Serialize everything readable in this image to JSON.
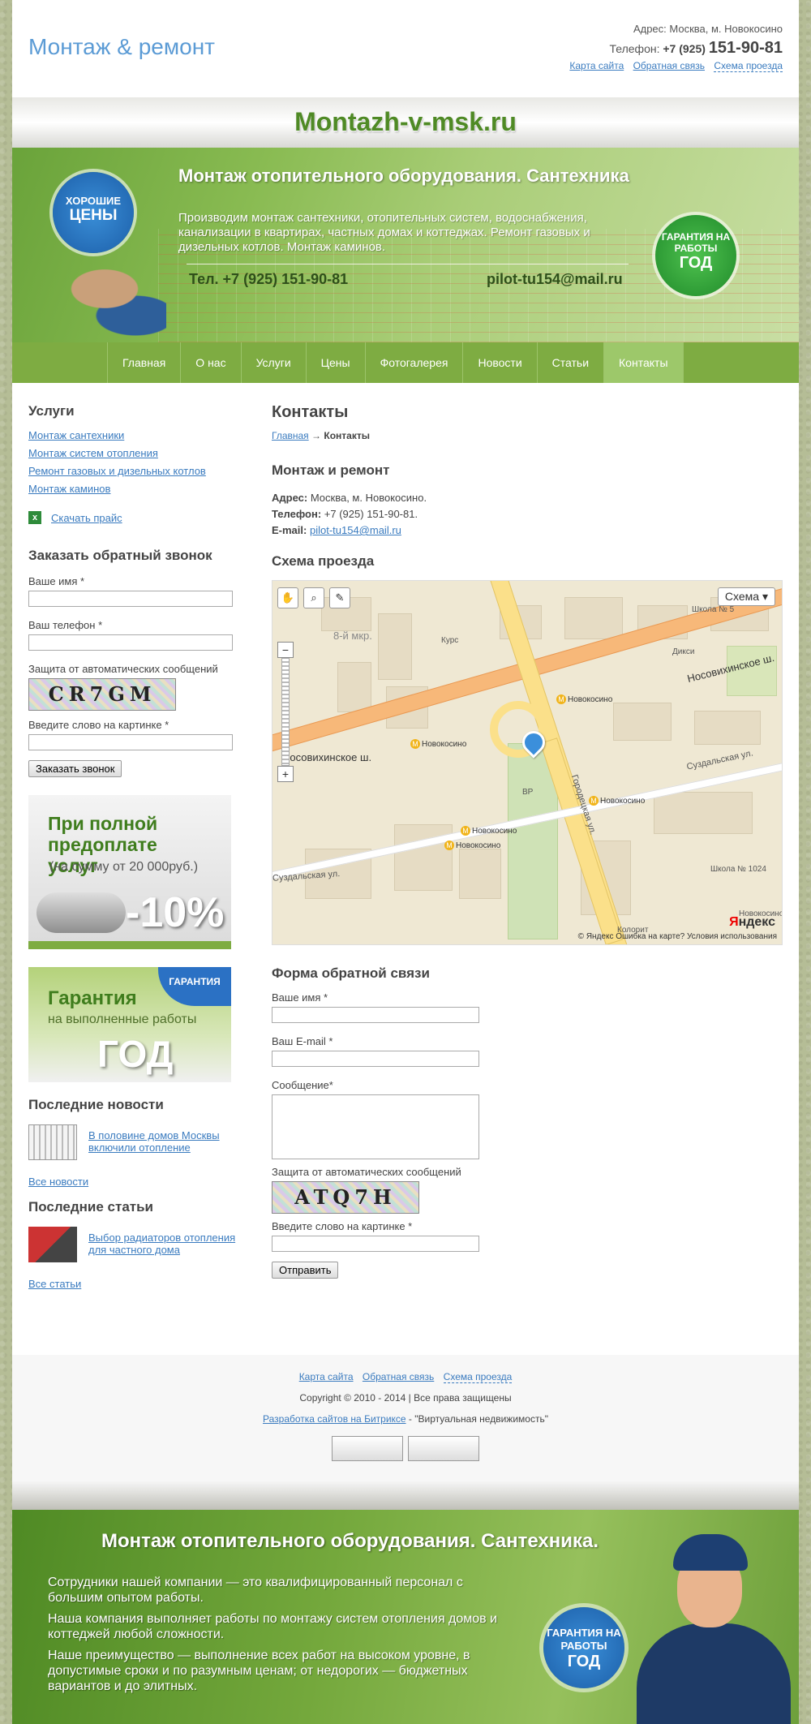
{
  "header": {
    "site_title": "Монтаж & ремонт",
    "address": "Адрес: Москва, м. Новокосино",
    "phone_label": "Телефон:",
    "phone_code": "+7 (925)",
    "phone_number": "151-90-81",
    "links": [
      "Карта сайта",
      "Обратная связь",
      "Схема проезда"
    ]
  },
  "banner": {
    "domain": "Montazh-v-msk.ru",
    "title": "Монтаж отопительного оборудования. Сантехника",
    "text": "Производим монтаж сантехники, отопительных систем, водоснабжения, канализации в квартирах, частных домах и коттеджах. Ремонт газовых и дизельных котлов. Монтаж каминов.",
    "phone": "Тел. +7 (925) 151-90-81",
    "email": "pilot-tu154@mail.ru",
    "badge_prices_small": "ХОРОШИЕ",
    "badge_prices_big": "ЦЕНЫ",
    "badge_guarantee_small": "ГАРАНТИЯ НА РАБОТЫ",
    "badge_guarantee_big": "ГОД"
  },
  "nav": {
    "items": [
      "Главная",
      "О нас",
      "Услуги",
      "Цены",
      "Фотогалерея",
      "Новости",
      "Статьи",
      "Контакты"
    ],
    "active": "Контакты"
  },
  "sidebar": {
    "services_title": "Услуги",
    "services": [
      "Монтаж сантехники",
      "Монтаж систем отопления",
      "Ремонт газовых и дизельных котлов",
      "Монтаж каминов"
    ],
    "price_link": "Скачать прайс",
    "callback": {
      "title": "Заказать обратный звонок",
      "name_label": "Ваше имя *",
      "phone_label": "Ваш телефон *",
      "captcha_label": "Защита от автоматических сообщений",
      "captcha_text": "CR7GM",
      "word_label": "Введите слово на картинке *",
      "button": "Заказать звонок"
    },
    "promo_discount": {
      "line1": "При полной предоплате услуг",
      "line2": "(на сумму от 20 000руб.)",
      "line3": "-10%"
    },
    "promo_guarantee": {
      "tag": "ГАРАНТИЯ",
      "line1": "Гарантия",
      "line2": "на выполненные работы",
      "line3": "ГОД"
    },
    "news_title": "Последние новости",
    "news_item": "В половине домов Москвы включили отопление",
    "news_all": "Все новости",
    "articles_title": "Последние статьи",
    "article_item": "Выбор радиаторов отопления для частного дома",
    "articles_all": "Все статьи"
  },
  "main": {
    "title": "Контакты",
    "breadcrumb_home": "Главная",
    "breadcrumb_sep": "→",
    "breadcrumb_current": "Контакты",
    "company": "Монтаж и ремонт",
    "address_label": "Адрес:",
    "address_value": "Москва, м. Новокосино.",
    "phone_label": "Телефон:",
    "phone_value": "+7 (925) 151-90-81.",
    "email_label": "E-mail:",
    "email_value": "pilot-tu154@mail.ru",
    "map_title": "Схема проезда",
    "map": {
      "type_label": "Схема ▾",
      "district": "8-й мкр.",
      "streets": [
        "Носовихинское ш.",
        "Носовихинское ш.",
        "Суздальская ул.",
        "Городецкая ул.",
        "Суздальская ул."
      ],
      "metro": [
        "Новокосино",
        "Новокосино",
        "Новокосино",
        "Новокосино",
        "Новокосино"
      ],
      "places": [
        "Курс",
        "Дикси",
        "Школа № 5",
        "Школа № 1024",
        "Колорит",
        "ВР",
        "Новокосино"
      ],
      "copyright": "© Яндекс  Ошибка на карте?  Условия использования",
      "logo_prefix": "Я",
      "logo_rest": "ндекс"
    },
    "feedback": {
      "title": "Форма обратной связи",
      "name_label": "Ваше имя *",
      "email_label": "Ваш E-mail *",
      "message_label": "Сообщение*",
      "captcha_label": "Защита от автоматических сообщений",
      "captcha_text": "ATQ7H",
      "word_label": "Введите слово на картинке *",
      "button": "Отправить"
    }
  },
  "footer": {
    "links": [
      "Карта сайта",
      "Обратная связь",
      "Схема проезда"
    ],
    "copyright": "Copyright © 2010 - 2014  |  Все права защищены",
    "dev_link": "Разработка сайтов на Битриксе",
    "dev_suffix": " - \"Виртуальная недвижимость\""
  },
  "bottom_banner": {
    "title": "Монтаж отопительного оборудования. Сантехника.",
    "p1": "Сотрудники нашей компании — это квалифицированный персонал с большим опытом работы.",
    "p2": "Наша компания выполняет работы по монтажу систем отопления домов и коттеджей любой сложности.",
    "p3": "Наше преимущество — выполнение всех работ на высоком уровне, в допустимые сроки и по разумным ценам; от недорогих — бюджетных вариантов и до элитных.",
    "badge_small": "ГАРАНТИЯ НА РАБОТЫ",
    "badge_big": "ГОД"
  },
  "colors": {
    "accent_green": "#7eac42",
    "link_blue": "#3a7bbf",
    "title_blue": "#5b9bd5"
  }
}
